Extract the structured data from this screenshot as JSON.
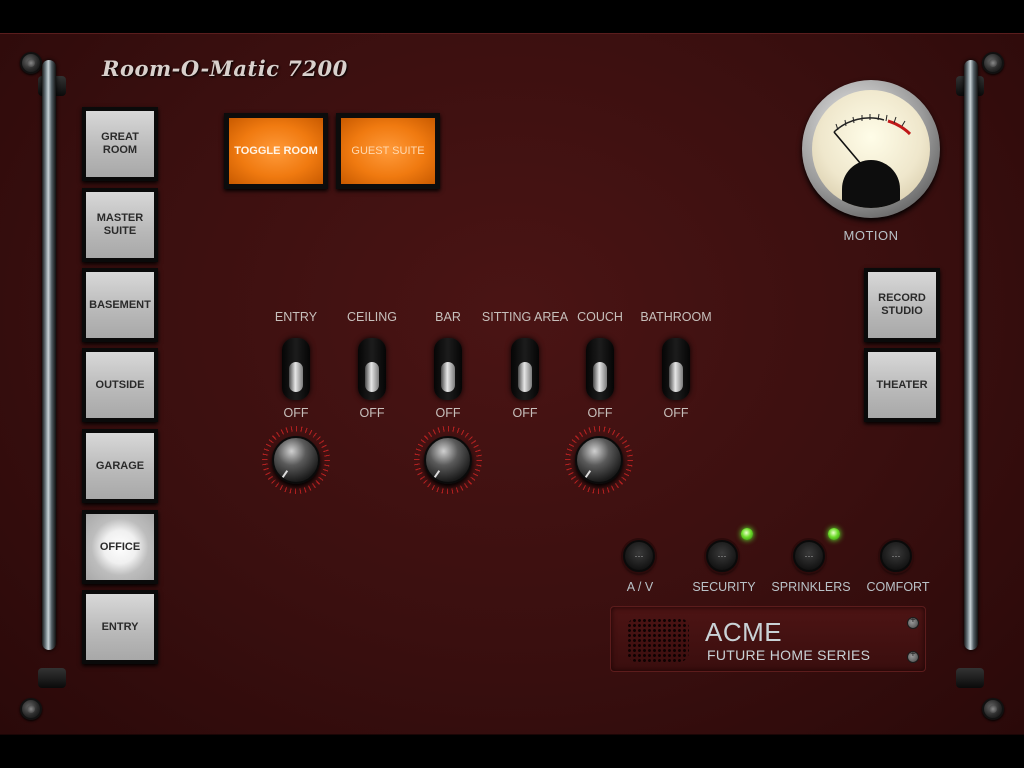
{
  "app": {
    "title": "Room-O-Matic 7200"
  },
  "rooms": [
    {
      "label": "GREAT ROOM",
      "active": false
    },
    {
      "label": "MASTER SUITE",
      "active": false
    },
    {
      "label": "BASEMENT",
      "active": false
    },
    {
      "label": "OUTSIDE",
      "active": false
    },
    {
      "label": "GARAGE",
      "active": false
    },
    {
      "label": "OFFICE",
      "active": true
    },
    {
      "label": "ENTRY",
      "active": false
    }
  ],
  "top_buttons": {
    "toggle_room": "TOGGLE ROOM",
    "guest_suite": "GUEST SUITE"
  },
  "gauge": {
    "label": "MOTION"
  },
  "side_rooms": [
    {
      "label": "RECORD STUDIO"
    },
    {
      "label": "THEATER"
    }
  ],
  "switches": [
    {
      "label": "ENTRY",
      "state": "OFF"
    },
    {
      "label": "CEILING",
      "state": "OFF"
    },
    {
      "label": "BAR",
      "state": "OFF"
    },
    {
      "label": "SITTING AREA",
      "state": "OFF"
    },
    {
      "label": "COUCH",
      "state": "OFF"
    },
    {
      "label": "BATHROOM",
      "state": "OFF"
    }
  ],
  "systems": [
    {
      "label": "A / V",
      "led_on": false
    },
    {
      "label": "SECURITY",
      "led_on": true
    },
    {
      "label": "SPRINKLERS",
      "led_on": true
    },
    {
      "label": "COMFORT",
      "led_on": false
    }
  ],
  "brand": {
    "name": "ACME",
    "series": "FUTURE HOME SERIES"
  },
  "colors": {
    "panel": "#3a0f0f",
    "accent_orange": "#f07a10",
    "led_green": "#6ddc2a"
  }
}
